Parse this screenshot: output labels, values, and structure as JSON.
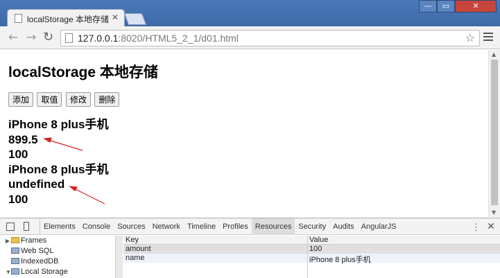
{
  "browser": {
    "tab_title": "localStorage 本地存储",
    "url_host": "127.0.0.1",
    "url_rest": ":8020/HTML5_2_1/d01.html"
  },
  "page": {
    "title": "localStorage 本地存储",
    "buttons": [
      "添加",
      "取值",
      "修改",
      "删除"
    ],
    "output": [
      "iPhone 8 plus手机",
      "899.5",
      "100",
      "iPhone 8 plus手机",
      "undefined",
      "100"
    ]
  },
  "devtools": {
    "tabs": [
      "Elements",
      "Console",
      "Sources",
      "Network",
      "Timeline",
      "Profiles",
      "Resources",
      "Security",
      "Audits",
      "AngularJS"
    ],
    "active_tab": "Resources",
    "tree": [
      "Frames",
      "Web SQL",
      "IndexedDB",
      "Local Storage"
    ],
    "columns": [
      "Key",
      "Value"
    ],
    "rows": [
      {
        "key": "amount",
        "value": "100"
      },
      {
        "key": "name",
        "value": "iPhone 8 plus手机"
      }
    ]
  },
  "colors": {
    "arrow": "#d32020",
    "titlebar": "#4a78b8"
  }
}
